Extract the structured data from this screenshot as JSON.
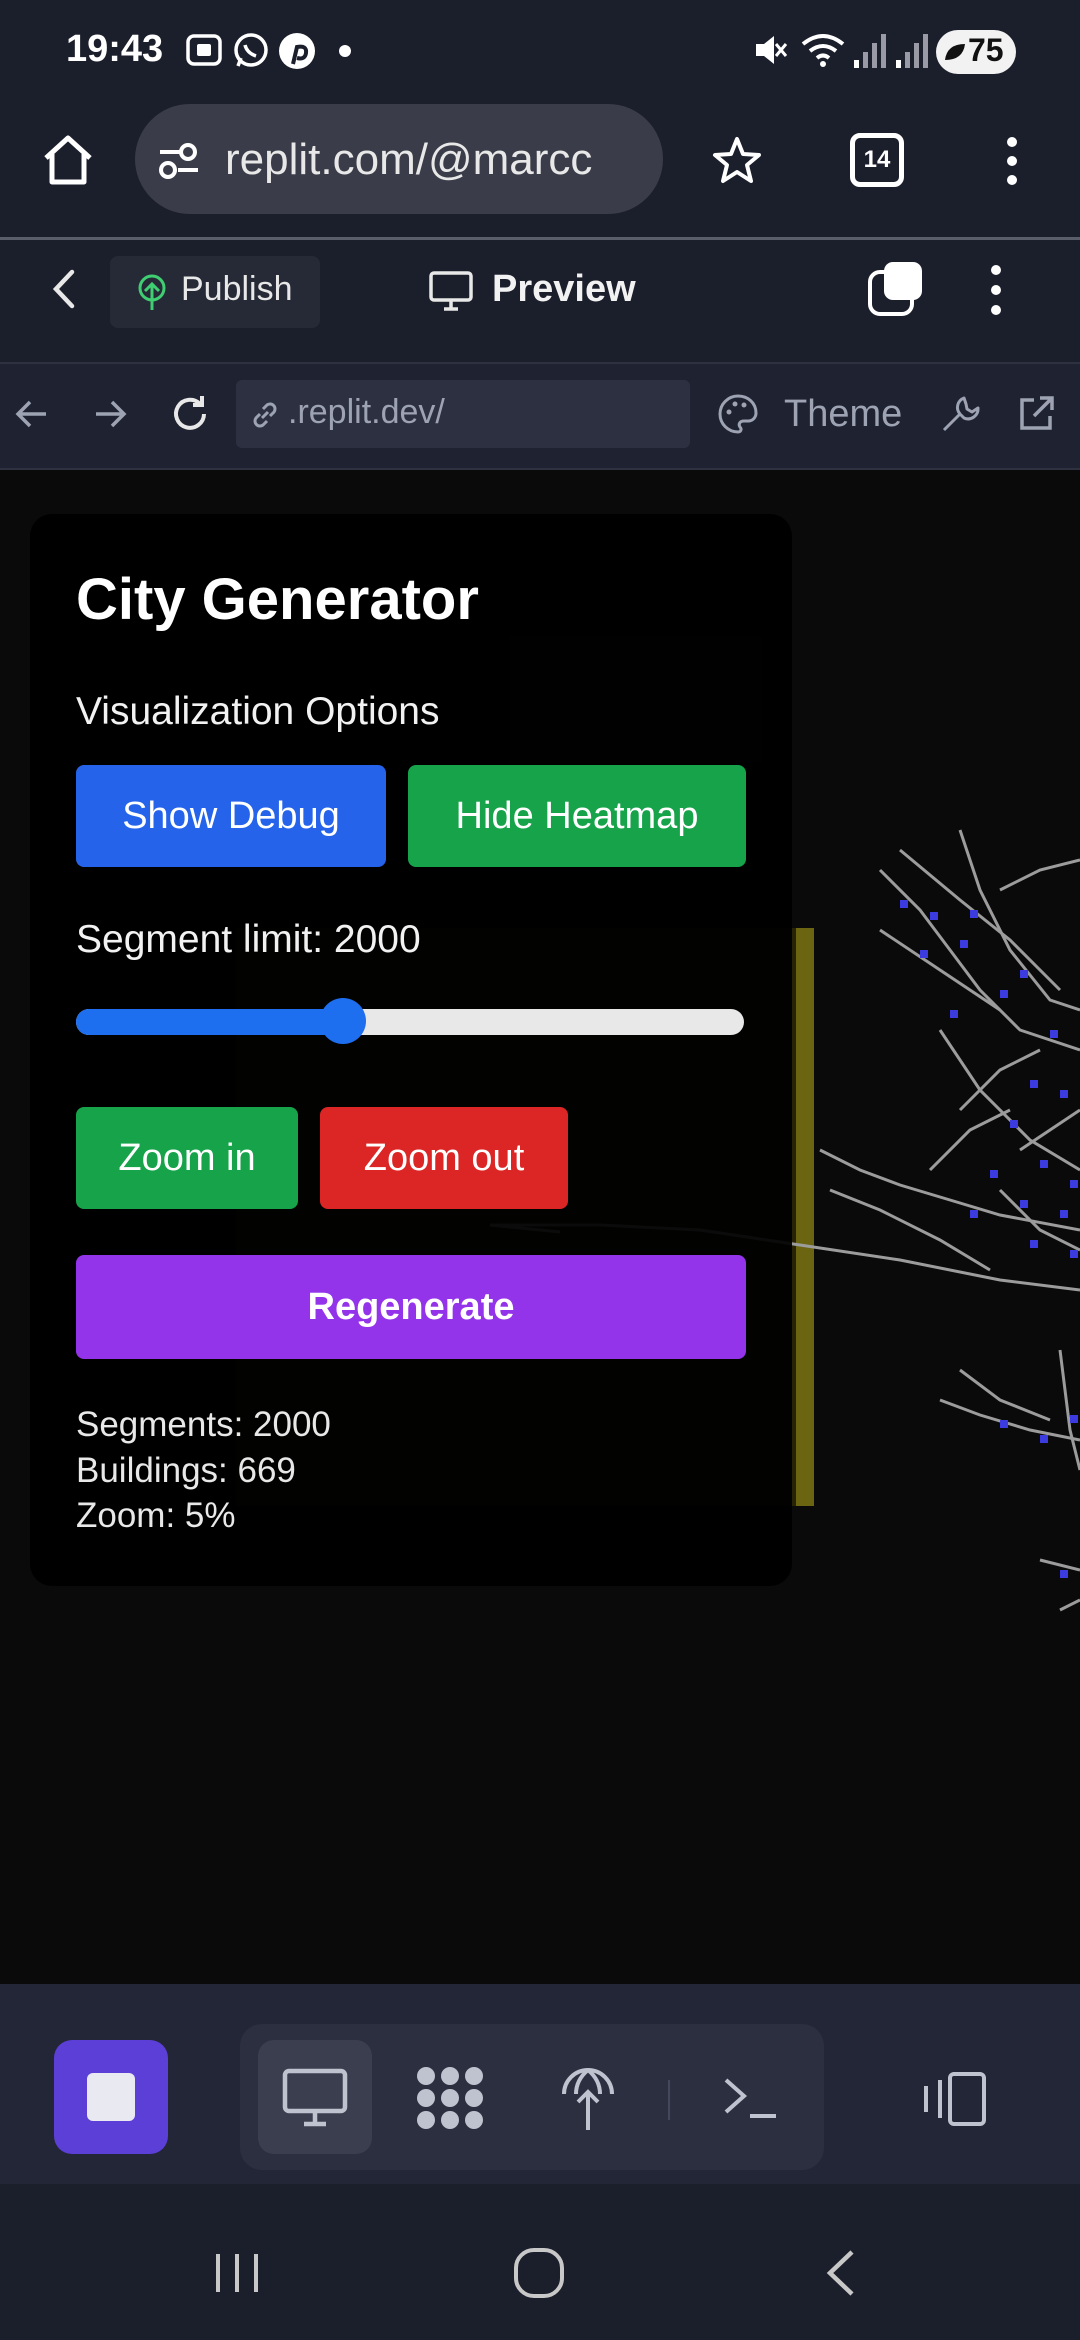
{
  "status_bar": {
    "time": "19:43",
    "battery": "75",
    "icons": [
      "screenshot-icon",
      "whatsapp-icon",
      "pinterest-icon",
      "dot-icon",
      "mute-icon",
      "wifi-icon",
      "signal-icon",
      "signal-icon-2"
    ]
  },
  "browser": {
    "url": "replit.com/@marcc",
    "tab_count": "14",
    "icons": [
      "home-icon",
      "site-settings-icon",
      "star-icon",
      "tabs-icon",
      "more-vert-icon"
    ]
  },
  "replit_header": {
    "publish_label": "Publish",
    "preview_label": "Preview"
  },
  "preview_toolbar": {
    "url": ".replit.dev/",
    "theme_label": "Theme"
  },
  "panel": {
    "title": "City Generator",
    "viz_label": "Visualization Options",
    "show_debug_label": "Show Debug",
    "hide_heatmap_label": "Hide Heatmap",
    "segment_limit_label": "Segment limit: 2000",
    "slider_value_fraction": 0.4,
    "zoom_in_label": "Zoom in",
    "zoom_out_label": "Zoom out",
    "regenerate_label": "Regenerate",
    "stats": {
      "segments": "Segments: 2000",
      "buildings": "Buildings: 669",
      "zoom": "Zoom: 5%"
    }
  },
  "colors": {
    "accent_blue": "#2563eb",
    "accent_green": "#16a34a",
    "accent_red": "#dc2626",
    "accent_purple": "#9333ea",
    "stop_button": "#5b3fd6"
  },
  "bottom_bar": {
    "icons": [
      "stop-icon",
      "preview-monitor-icon",
      "apps-grid-icon",
      "deploy-icon",
      "terminal-icon",
      "split-view-icon"
    ]
  },
  "android_nav": {
    "icons": [
      "recents-icon",
      "home-circle-icon",
      "back-icon"
    ]
  }
}
